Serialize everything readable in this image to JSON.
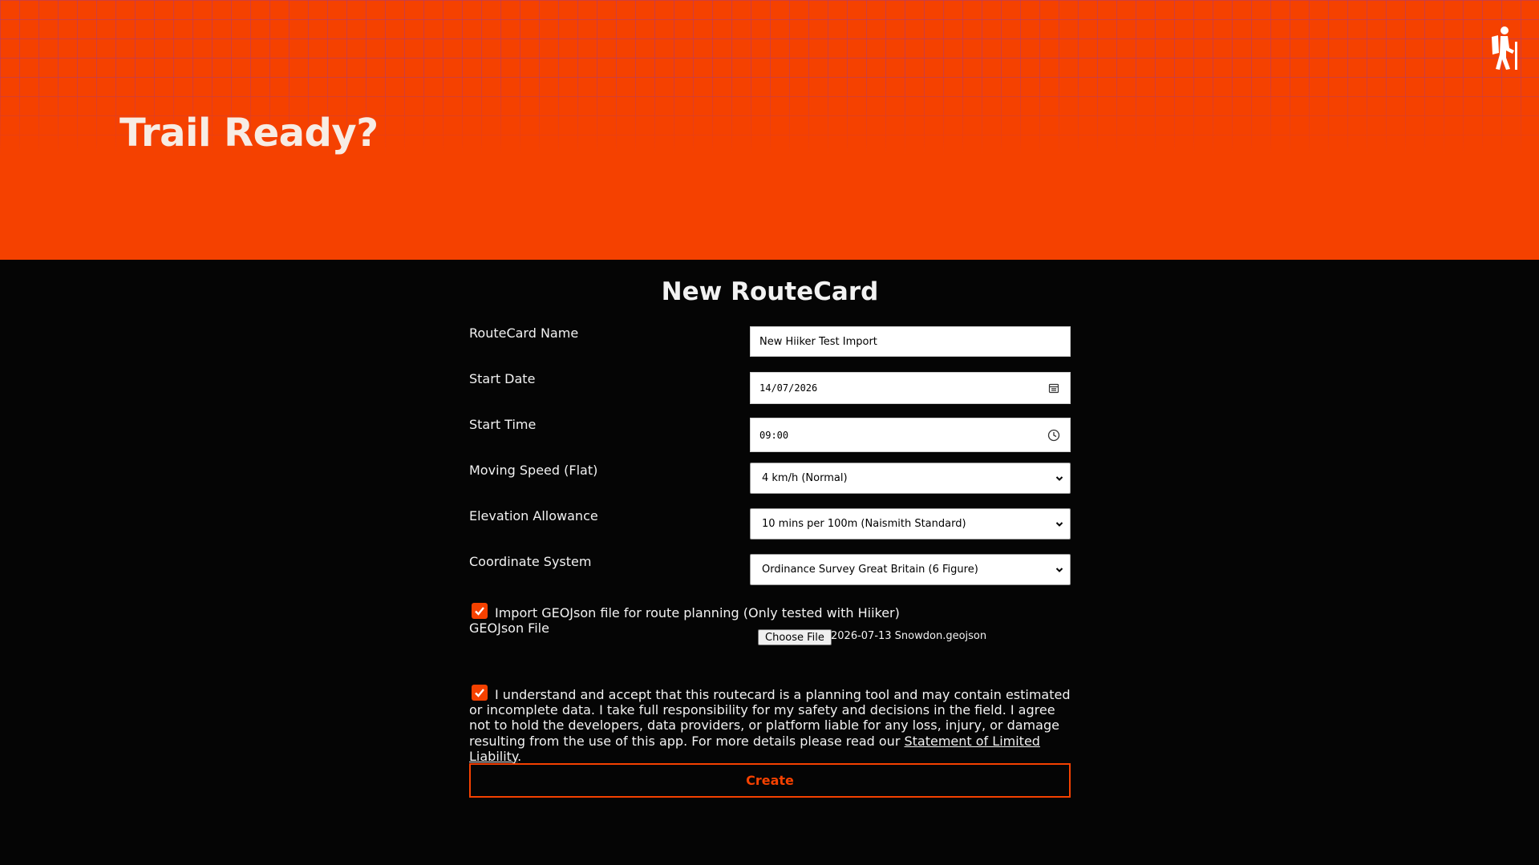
{
  "header": {
    "title": "Trail Ready?",
    "logo_icon": "hiker-icon"
  },
  "form": {
    "title": "New RouteCard",
    "fields": {
      "name": {
        "label": "RouteCard Name",
        "value": "New Hiiker Test Import"
      },
      "start_date": {
        "label": "Start Date",
        "value": "14/07/2026"
      },
      "start_time": {
        "label": "Start Time",
        "value": "09:00"
      },
      "moving_speed": {
        "label": "Moving Speed (Flat)",
        "value": "4 km/h (Normal)"
      },
      "elevation_allowance": {
        "label": "Elevation Allowance",
        "value": "10 mins per 100m (Naismith Standard)"
      },
      "coordinate_system": {
        "label": "Coordinate System",
        "value": "Ordinance Survey Great Britain (6 Figure)"
      }
    },
    "import_geojson": {
      "checked": true,
      "label": "Import GEOJson file for route planning (Only tested with Hiiker)"
    },
    "geojson_file": {
      "label": "GEOJson File",
      "button_label": "Choose File",
      "file_name": "2026-07-13 Snowdon.geojson"
    },
    "disclaimer": {
      "checked": true,
      "text": "I understand and accept that this routecard is a planning tool and may contain estimated or incomplete data. I take full responsibility for my safety and decisions in the field. I agree not to hold the developers, data providers, or platform liable for any loss, injury, or damage resulting from the use of this app. For more details please read our ",
      "link_text": "Statement of Limited Liability",
      "suffix": "."
    },
    "submit_label": "Create"
  },
  "colors": {
    "accent": "#f54100",
    "background": "#050505",
    "text": "#f2f2f2"
  }
}
